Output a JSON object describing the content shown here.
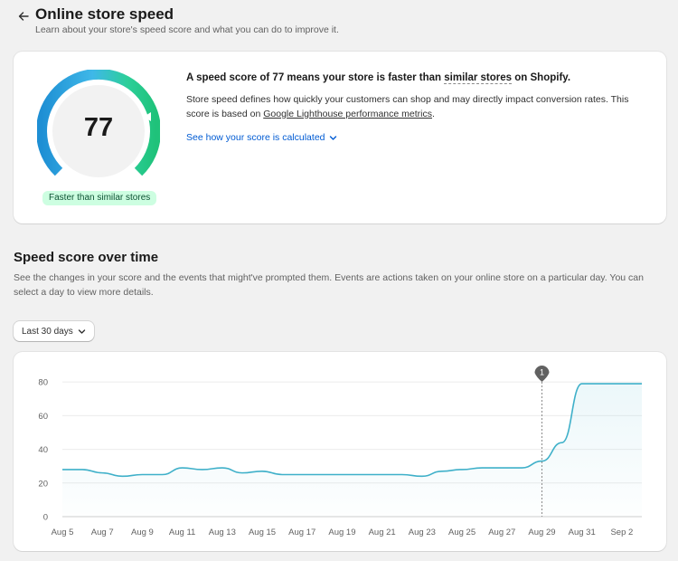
{
  "header": {
    "title": "Online store speed",
    "subtitle": "Learn about your store's speed score and what you can do to improve it."
  },
  "score_card": {
    "score": "77",
    "badge": "Faster than similar stores",
    "headline_before": "A speed score of 77 means your store is faster than ",
    "headline_dotted": "similar stores",
    "headline_after": " on Shopify.",
    "desc_text": "Store speed defines how quickly your customers can shop and may directly impact conversion rates. This score is based on ",
    "desc_link": "Google Lighthouse performance metrics",
    "desc_end": ".",
    "calc_link": "See how your score is calculated"
  },
  "over_time": {
    "title": "Speed score over time",
    "description": "See the changes in your score and the events that might've prompted them. Events are actions taken on your online store on a particular day. You can select a day to view more details.",
    "range_label": "Last 30 days"
  },
  "colors": {
    "line": "#3fb0c9",
    "badge_bg": "#cdfee1",
    "link": "#005bd3",
    "marker": "#616161"
  },
  "chart_data": {
    "type": "line",
    "x": [
      "Aug 5",
      "Aug 6",
      "Aug 7",
      "Aug 8",
      "Aug 9",
      "Aug 10",
      "Aug 11",
      "Aug 12",
      "Aug 13",
      "Aug 14",
      "Aug 15",
      "Aug 16",
      "Aug 17",
      "Aug 18",
      "Aug 19",
      "Aug 20",
      "Aug 21",
      "Aug 22",
      "Aug 23",
      "Aug 24",
      "Aug 25",
      "Aug 26",
      "Aug 27",
      "Aug 28",
      "Aug 29",
      "Aug 30",
      "Aug 31",
      "Sep 1",
      "Sep 2",
      "Sep 3"
    ],
    "x_tick_labels": [
      "Aug 5",
      "Aug 7",
      "Aug 9",
      "Aug 11",
      "Aug 13",
      "Aug 15",
      "Aug 17",
      "Aug 19",
      "Aug 21",
      "Aug 23",
      "Aug 25",
      "Aug 27",
      "Aug 29",
      "Aug 31",
      "Sep 2"
    ],
    "series": [
      {
        "values": [
          28,
          28,
          26,
          24,
          25,
          25,
          29,
          28,
          29,
          26,
          27,
          25,
          25,
          25,
          25,
          25,
          25,
          25,
          24,
          27,
          28,
          29,
          29,
          29,
          33,
          44,
          79,
          79,
          79,
          79
        ]
      }
    ],
    "ylim": [
      0,
      86
    ],
    "yticks": [
      0,
      20,
      40,
      60,
      80
    ],
    "grid": true,
    "event_marker": {
      "x": "Aug 29",
      "label": "1"
    }
  }
}
